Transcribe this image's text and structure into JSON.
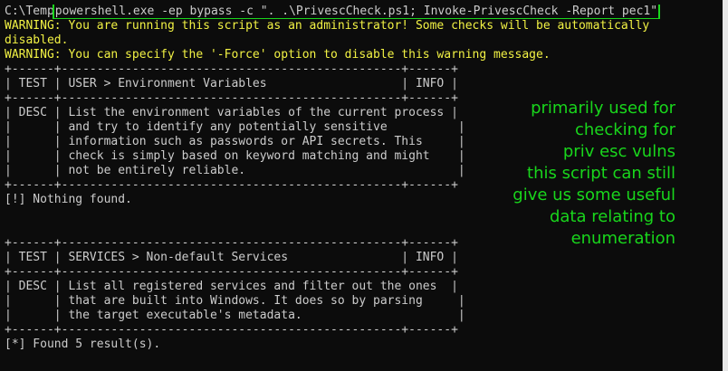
{
  "prompt": "C:\\Temp",
  "command": "powershell.exe -ep bypass -c \". .\\PrivescCheck.ps1; Invoke-PrivescCheck -Report pec1\"",
  "warnings": [
    "WARNING: You are running this script as an administrator! Some checks will be automatically",
    "disabled.",
    "WARNING: You can specify the '-Force' option to disable this warning message."
  ],
  "checks": [
    {
      "border": "+------+------------------------------------------------+------+",
      "header": "| TEST | USER > Environment Variables                   | INFO |",
      "desc": [
        "| DESC | List the environment variables of the current process |",
        "|      | and try to identify any potentially sensitive          |",
        "|      | information such as passwords or API secrets. This     |",
        "|      | check is simply based on keyword matching and might    |",
        "|      | not be entirely reliable.                              |"
      ],
      "result": "[!] Nothing found."
    },
    {
      "border": "+------+------------------------------------------------+------+",
      "header": "| TEST | SERVICES > Non-default Services                | INFO |",
      "desc": [
        "| DESC | List all registered services and filter out the ones  |",
        "|      | that are built into Windows. It does so by parsing     |",
        "|      | the target executable's metadata.                      |"
      ],
      "result": "[*] Found 5 result(s)."
    }
  ],
  "annotation": "primarily used for\nchecking for\npriv esc vulns\nthis script can still\ngive us some useful\ndata relating to\nenumeration",
  "colors": {
    "background": "#0c0c0c",
    "text": "#cccccc",
    "warning": "#f2f244",
    "highlight": "#19d61c"
  }
}
